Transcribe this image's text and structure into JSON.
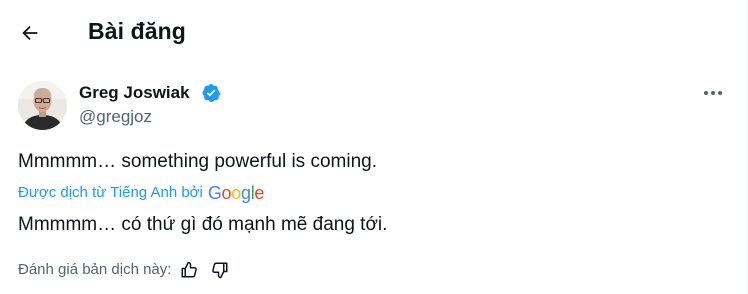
{
  "header": {
    "back_icon": "arrow-left-icon",
    "title": "Bài đăng"
  },
  "author": {
    "name": "Greg Joswiak",
    "handle": "@gregjoz",
    "verified_icon": "verified-badge-icon",
    "verified_color": "#1d9bf0"
  },
  "more_icon": "more-horizontal-icon",
  "post": {
    "text": "Mmmmm… something powerful is coming.",
    "translated_by_label": "Được dịch từ Tiếng Anh bởi",
    "translation_provider": "Google",
    "translated_text": "Mmmmm… có thứ gì đó mạnh mẽ đang tới."
  },
  "rating": {
    "label": "Đánh giá bản dịch này:",
    "thumbs_up_icon": "thumbs-up-icon",
    "thumbs_down_icon": "thumbs-down-icon"
  },
  "colors": {
    "text_primary": "#0f1419",
    "text_secondary": "#536471",
    "accent": "#1d9bf0",
    "google_blue": "#4285f4",
    "google_red": "#ea4335",
    "google_yellow": "#fbbc05",
    "google_green": "#34a853"
  }
}
